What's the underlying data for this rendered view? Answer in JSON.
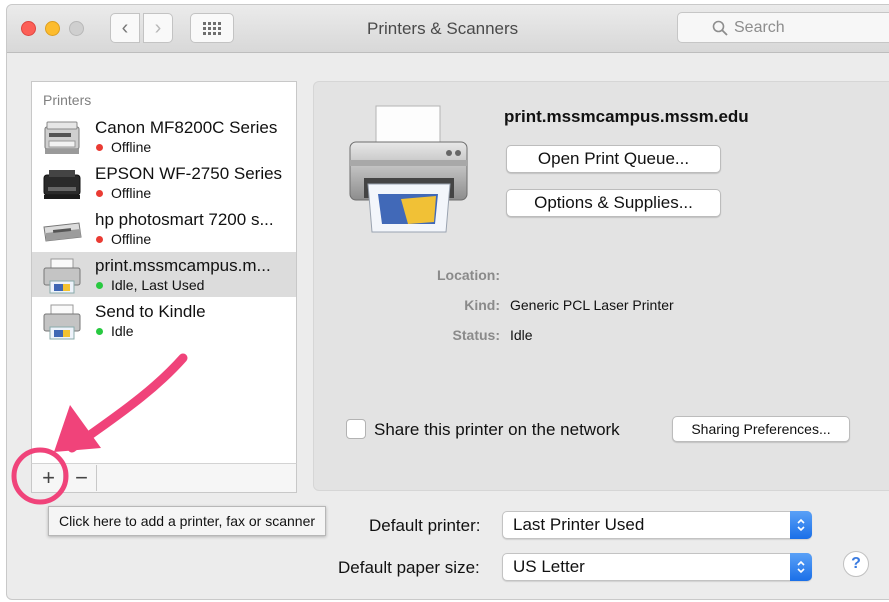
{
  "window": {
    "title": "Printers & Scanners",
    "search_placeholder": "Search"
  },
  "printers": {
    "header": "Printers",
    "items": [
      {
        "name": "Canon MF8200C Series",
        "status": "Offline",
        "status_color": "#ea3b33",
        "icon": "multifunction-printer-icon"
      },
      {
        "name": "EPSON WF-2750 Series",
        "status": "Offline",
        "status_color": "#ea3b33",
        "icon": "inkjet-printer-icon"
      },
      {
        "name": "hp photosmart 7200 s...",
        "status": "Offline",
        "status_color": "#ea3b33",
        "icon": "photo-printer-icon"
      },
      {
        "name": "print.mssmcampus.m...",
        "status": "Idle, Last Used",
        "status_color": "#28c940",
        "icon": "network-printer-icon",
        "selected": true
      },
      {
        "name": "Send to Kindle",
        "status": "Idle",
        "status_color": "#28c940",
        "icon": "network-printer-icon"
      }
    ],
    "add_label": "+",
    "remove_label": "−"
  },
  "detail": {
    "title": "print.mssmcampus.mssm.edu",
    "open_queue_label": "Open Print Queue...",
    "options_label": "Options & Supplies...",
    "location_label": "Location:",
    "location_value": "",
    "kind_label": "Kind:",
    "kind_value": "Generic PCL Laser Printer",
    "status_label": "Status:",
    "status_value": "Idle",
    "share_label": "Share this printer on the network",
    "share_checked": false,
    "sharing_prefs_label": "Sharing Preferences..."
  },
  "defaults": {
    "default_printer_label": "Default printer:",
    "default_printer_value": "Last Printer Used",
    "default_paper_label": "Default paper size:",
    "default_paper_value": "US Letter",
    "help_label": "?"
  },
  "tooltip": {
    "text": "Click here to add a printer, fax or scanner"
  },
  "annotation": {
    "color": "#f0437a"
  }
}
